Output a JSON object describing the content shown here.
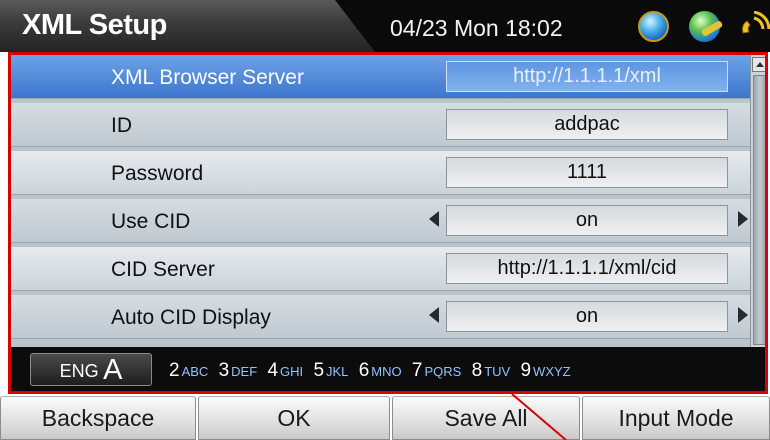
{
  "header": {
    "title": "XML Setup",
    "datetime": "04/23 Mon 18:02",
    "icons": [
      "globe-icon",
      "network-globe-icon",
      "phone-ring-icon"
    ]
  },
  "settings": [
    {
      "label": "XML Browser Server",
      "value": "http://1.1.1.1/xml",
      "selected": true,
      "has_arrows": false
    },
    {
      "label": "ID",
      "value": "addpac",
      "selected": false,
      "has_arrows": false
    },
    {
      "label": "Password",
      "value": "1111",
      "selected": false,
      "has_arrows": false
    },
    {
      "label": "Use CID",
      "value": "on",
      "selected": false,
      "has_arrows": true
    },
    {
      "label": "CID Server",
      "value": "http://1.1.1.1/xml/cid",
      "selected": false,
      "has_arrows": false
    },
    {
      "label": "Auto CID Display",
      "value": "on",
      "selected": false,
      "has_arrows": true
    }
  ],
  "keypad": {
    "lang_prefix": "ENG",
    "lang_mode": "A",
    "keys": [
      {
        "digit": "2",
        "letters": "ABC"
      },
      {
        "digit": "3",
        "letters": "DEF"
      },
      {
        "digit": "4",
        "letters": "GHI"
      },
      {
        "digit": "5",
        "letters": "JKL"
      },
      {
        "digit": "6",
        "letters": "MNO"
      },
      {
        "digit": "7",
        "letters": "PQRS"
      },
      {
        "digit": "8",
        "letters": "TUV"
      },
      {
        "digit": "9",
        "letters": "WXYZ"
      }
    ]
  },
  "softkeys": {
    "backspace": "Backspace",
    "ok": "OK",
    "save_all": "Save All",
    "input_mode": "Input Mode"
  },
  "colors": {
    "highlight_border": "#d80000",
    "selected_row": "#3c76cf",
    "keypad_letters": "#8fc4ff"
  }
}
